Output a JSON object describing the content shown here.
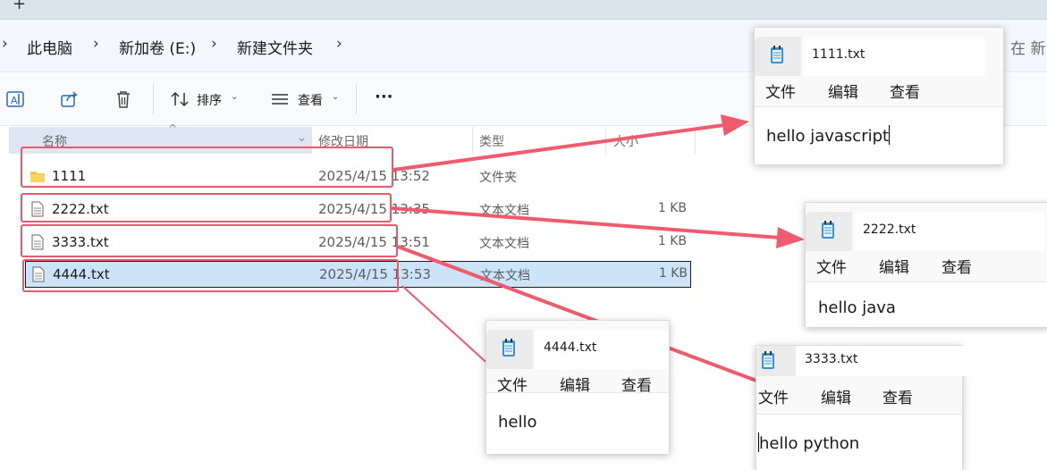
{
  "tabstrip": {
    "new_tab_label": "+"
  },
  "breadcrumb": {
    "items": [
      "此电脑",
      "新加卷 (E:)",
      "新建文件夹"
    ],
    "separator": "›",
    "search_hint": "在 新"
  },
  "toolbar": {
    "sort_label": "排序",
    "view_label": "查看",
    "more_label": "···"
  },
  "columns": {
    "name": "名称",
    "modified": "修改日期",
    "type": "类型",
    "size": "大小"
  },
  "files": [
    {
      "name": "1111",
      "modified": "2025/4/15 13:52",
      "type": "文件夹",
      "size": "",
      "kind": "folder"
    },
    {
      "name": "2222.txt",
      "modified": "2025/4/15 13:35",
      "type": "文本文档",
      "size": "1 KB",
      "kind": "text"
    },
    {
      "name": "3333.txt",
      "modified": "2025/4/15 13:51",
      "type": "文本文档",
      "size": "1 KB",
      "kind": "text"
    },
    {
      "name": "4444.txt",
      "modified": "2025/4/15 13:53",
      "type": "文本文档",
      "size": "1 KB",
      "kind": "text",
      "selected": true
    }
  ],
  "notepads": [
    {
      "title": "1111.txt",
      "menu": [
        "文件",
        "编辑",
        "查看"
      ],
      "content": "hello javascript"
    },
    {
      "title": "2222.txt",
      "menu": [
        "文件",
        "编辑",
        "查看"
      ],
      "content": "hello java"
    },
    {
      "title": "4444.txt",
      "menu": [
        "文件",
        "编辑",
        "查看"
      ],
      "content": "hello"
    },
    {
      "title": "3333.txt",
      "menu": [
        "文件",
        "编辑",
        "查看"
      ],
      "content": "hello python"
    }
  ],
  "colors": {
    "highlight": "#e8596c",
    "selected_row": "#cce4f7",
    "folder": "#f4c443"
  }
}
